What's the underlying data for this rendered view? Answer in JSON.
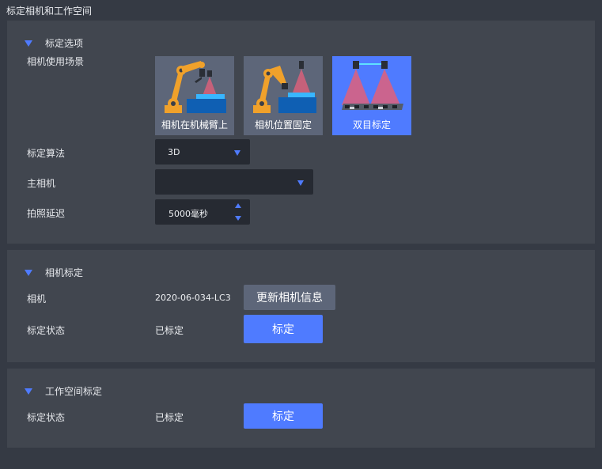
{
  "window": {
    "title": "标定相机和工作空间"
  },
  "calibration_options": {
    "header": "标定选项",
    "scene_label": "相机使用场景",
    "scenes": [
      {
        "label": "相机在机械臂上",
        "icon": "robot-arm-camera-icon",
        "selected": false
      },
      {
        "label": "相机位置固定",
        "icon": "fixed-camera-icon",
        "selected": false
      },
      {
        "label": "双目标定",
        "icon": "stereo-camera-icon",
        "selected": true
      }
    ],
    "algorithm_label": "标定算法",
    "algorithm_value": "3D",
    "main_camera_label": "主相机",
    "main_camera_value": "",
    "capture_delay_label": "拍照延迟",
    "capture_delay_value": "5000毫秒"
  },
  "camera_calibration": {
    "header": "相机标定",
    "camera_label": "相机",
    "camera_value": "2020-06-034-LC3",
    "update_button": "更新相机信息",
    "status_label": "标定状态",
    "status_value": "已标定",
    "calibrate_button": "标定"
  },
  "workspace_calibration": {
    "header": "工作空间标定",
    "status_label": "标定状态",
    "status_value": "已标定",
    "calibrate_button": "标定"
  },
  "colors": {
    "background": "#353a44",
    "panel": "#41464f",
    "accent": "#4f7bff",
    "button_gray": "#5d6679",
    "input": "#262a32"
  }
}
